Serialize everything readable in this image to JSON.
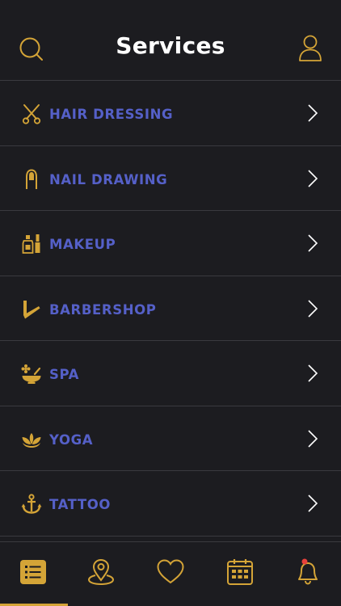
{
  "header": {
    "title": "Services",
    "search_icon": "search-icon",
    "profile_icon": "user-icon"
  },
  "colors": {
    "background": "#1c1c20",
    "accent_gold": "#d4a437",
    "label_blue": "#5560c8",
    "divider": "#3a3a3f",
    "notification_dot": "#e8413c"
  },
  "services": [
    {
      "label": "HAIR DRESSING",
      "icon": "scissors-icon"
    },
    {
      "label": "NAIL DRAWING",
      "icon": "nail-icon"
    },
    {
      "label": "MAKEUP",
      "icon": "makeup-icon"
    },
    {
      "label": "BARBERSHOP",
      "icon": "razor-icon"
    },
    {
      "label": "SPA",
      "icon": "spa-icon"
    },
    {
      "label": "YOGA",
      "icon": "lotus-icon"
    },
    {
      "label": "TATTOO",
      "icon": "anchor-icon"
    }
  ],
  "tabbar": {
    "tabs": [
      {
        "name": "list-tab",
        "icon": "list-icon",
        "active": true
      },
      {
        "name": "map-tab",
        "icon": "location-icon",
        "active": false
      },
      {
        "name": "favorites-tab",
        "icon": "heart-icon",
        "active": false
      },
      {
        "name": "calendar-tab",
        "icon": "calendar-icon",
        "active": false
      },
      {
        "name": "notifications-tab",
        "icon": "bell-icon",
        "active": false,
        "has_badge": true
      }
    ]
  }
}
